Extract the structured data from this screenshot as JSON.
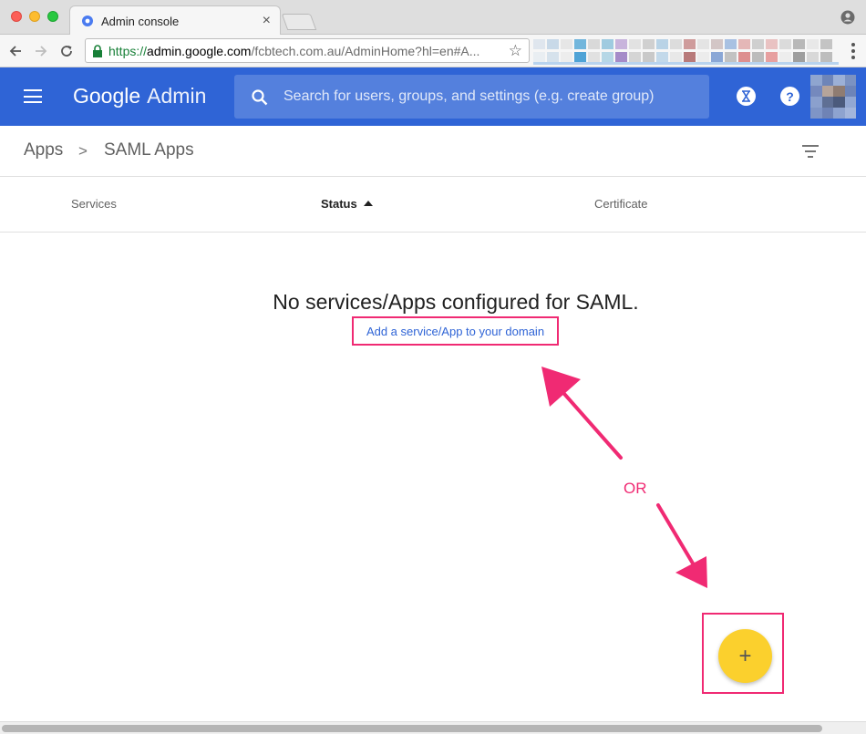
{
  "browser": {
    "tab_title": "Admin console",
    "tab_close": "×",
    "url": {
      "scheme": "https://",
      "host": "admin.google.com",
      "path": "/fcbtech.com.au/AdminHome?hl=en#A..."
    },
    "star": "☆"
  },
  "header": {
    "brand_google": "Google",
    "brand_admin": "Admin",
    "search_placeholder": "Search for users, groups, and settings (e.g. create group)",
    "hourglass_icon": "hourglass-icon",
    "help_label": "?"
  },
  "breadcrumb": {
    "apps": "Apps",
    "separator": ">",
    "current": "SAML Apps"
  },
  "table": {
    "columns": [
      "Services",
      "Status",
      "Certificate"
    ],
    "sorted_column": "Status",
    "sort_direction": "ascending"
  },
  "empty_state": {
    "message": "No services/Apps configured for SAML.",
    "add_link": "Add a service/App to your domain"
  },
  "annotation": {
    "or_label": "OR",
    "color": "#f02a73"
  },
  "fab": {
    "label": "+",
    "color": "#fbd02d"
  },
  "colors": {
    "appbar": "#2f64d6",
    "link": "#2f64d6"
  }
}
